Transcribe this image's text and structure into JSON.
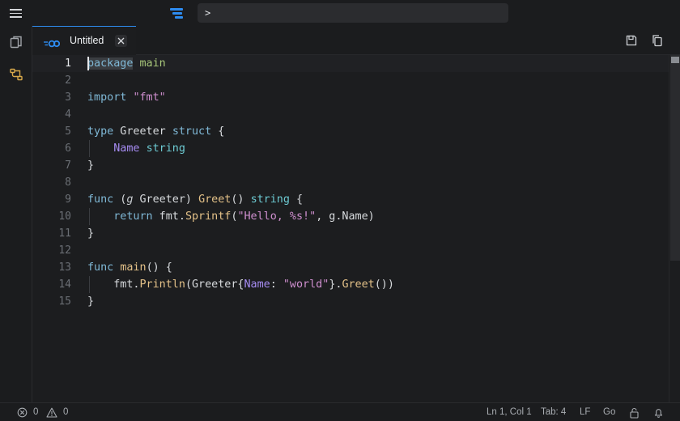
{
  "command_bar": {
    "value": ">"
  },
  "tabs": [
    {
      "label": "Untitled",
      "icon": "go-language-icon",
      "active": true
    }
  ],
  "editor": {
    "lines": [
      {
        "number": "1",
        "text": "package main"
      },
      {
        "number": "2",
        "text": ""
      },
      {
        "number": "3",
        "text": "import \"fmt\""
      },
      {
        "number": "4",
        "text": ""
      },
      {
        "number": "5",
        "text": "type Greeter struct {"
      },
      {
        "number": "6",
        "text": "    Name string"
      },
      {
        "number": "7",
        "text": "}"
      },
      {
        "number": "8",
        "text": ""
      },
      {
        "number": "9",
        "text": "func (g Greeter) Greet() string {"
      },
      {
        "number": "10",
        "text": "    return fmt.Sprintf(\"Hello, %s!\", g.Name)"
      },
      {
        "number": "11",
        "text": "}"
      },
      {
        "number": "12",
        "text": ""
      },
      {
        "number": "13",
        "text": "func main() {"
      },
      {
        "number": "14",
        "text": "    fmt.Println(Greeter{Name: \"world\"}.Greet())"
      },
      {
        "number": "15",
        "text": "}"
      }
    ],
    "active_line": "1"
  },
  "status": {
    "errors": "0",
    "warnings": "0",
    "position": "Ln 1, Col 1",
    "tab_size": "Tab: 4",
    "line_ending": "LF",
    "language": "Go"
  },
  "colors": {
    "accent": "#2e8cf0",
    "keyword": "#7fb8d6",
    "string": "#cf8fcf",
    "function": "#e3c188",
    "type": "#6cc9d1",
    "field": "#a68cf2"
  }
}
